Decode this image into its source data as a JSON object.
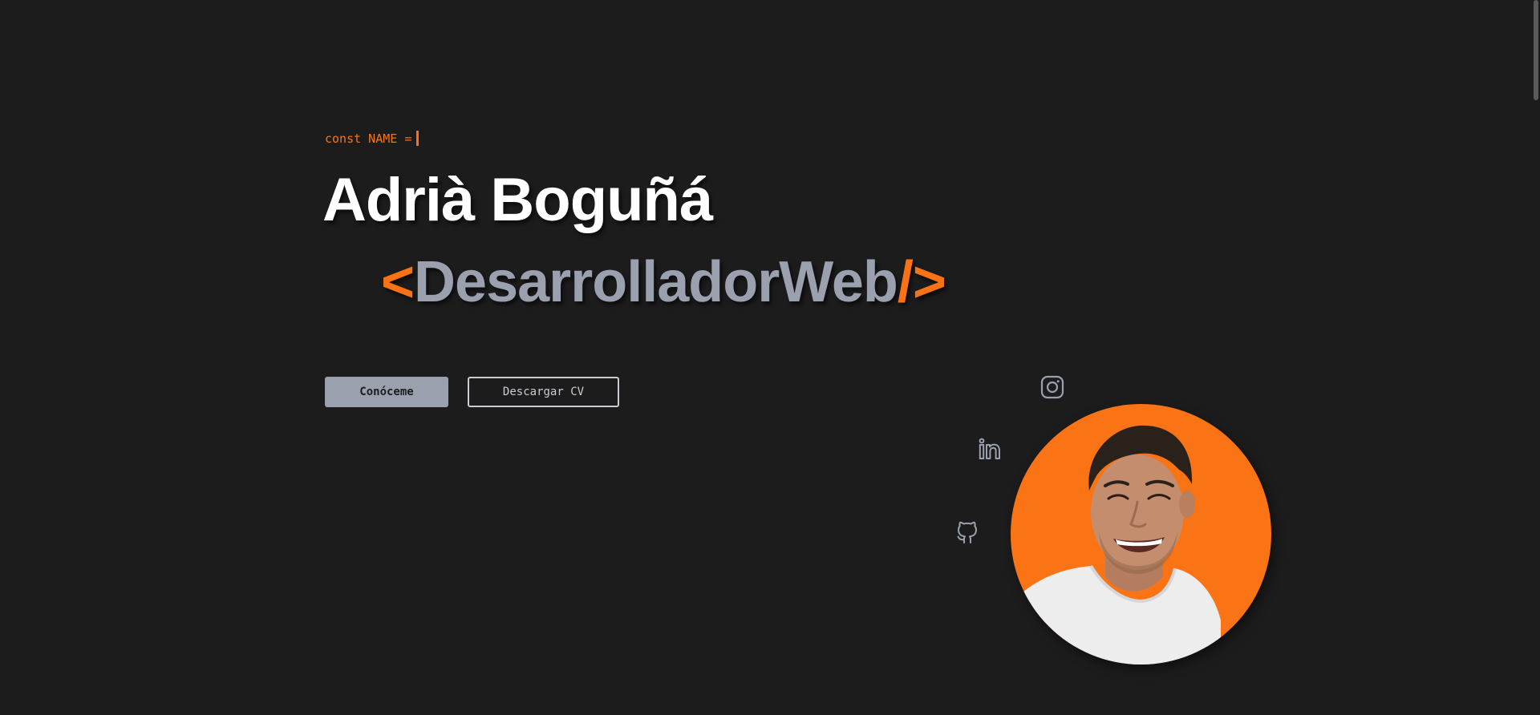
{
  "hero": {
    "code_prefix": "const NAME =",
    "name": "Adrià Boguñá",
    "role": {
      "open": "<",
      "text": "DesarrolladorWeb",
      "close": "/>"
    }
  },
  "buttons": {
    "primary_label": "Conóceme",
    "secondary_label": "Descargar CV"
  },
  "social": {
    "instagram_icon": "instagram-icon",
    "linkedin_icon": "linkedin-icon",
    "github_icon": "github-icon"
  },
  "colors": {
    "background": "#1c1c1d",
    "accent": "#f97316",
    "muted": "#9aa0ae",
    "text": "#ffffff"
  }
}
